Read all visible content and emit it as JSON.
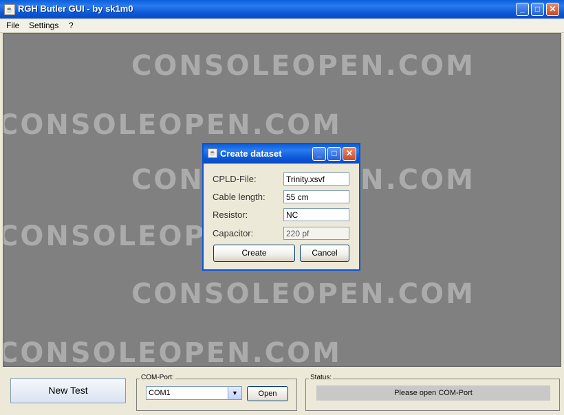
{
  "window": {
    "title": "RGH Butler GUI - by sk1m0"
  },
  "menu": {
    "items": [
      "File",
      "Settings",
      "?"
    ]
  },
  "watermark": {
    "text": "CONSOLEOPEN.COM"
  },
  "dialog": {
    "title": "Create dataset",
    "fields": [
      {
        "label": "CPLD-File:",
        "value": "Trinity.xsvf",
        "enabled": true
      },
      {
        "label": "Cable length:",
        "value": "55 cm",
        "enabled": true
      },
      {
        "label": "Resistor:",
        "value": "NC",
        "enabled": true
      },
      {
        "label": "Capacitor:",
        "value": "220 pf",
        "enabled": false
      }
    ],
    "create_label": "Create",
    "cancel_label": "Cancel"
  },
  "bottom": {
    "new_test_label": "New Test",
    "com_port": {
      "legend": "COM-Port:",
      "selected": "COM1",
      "open_label": "Open"
    },
    "status": {
      "legend": "Status:",
      "text": "Please open COM-Port"
    }
  }
}
